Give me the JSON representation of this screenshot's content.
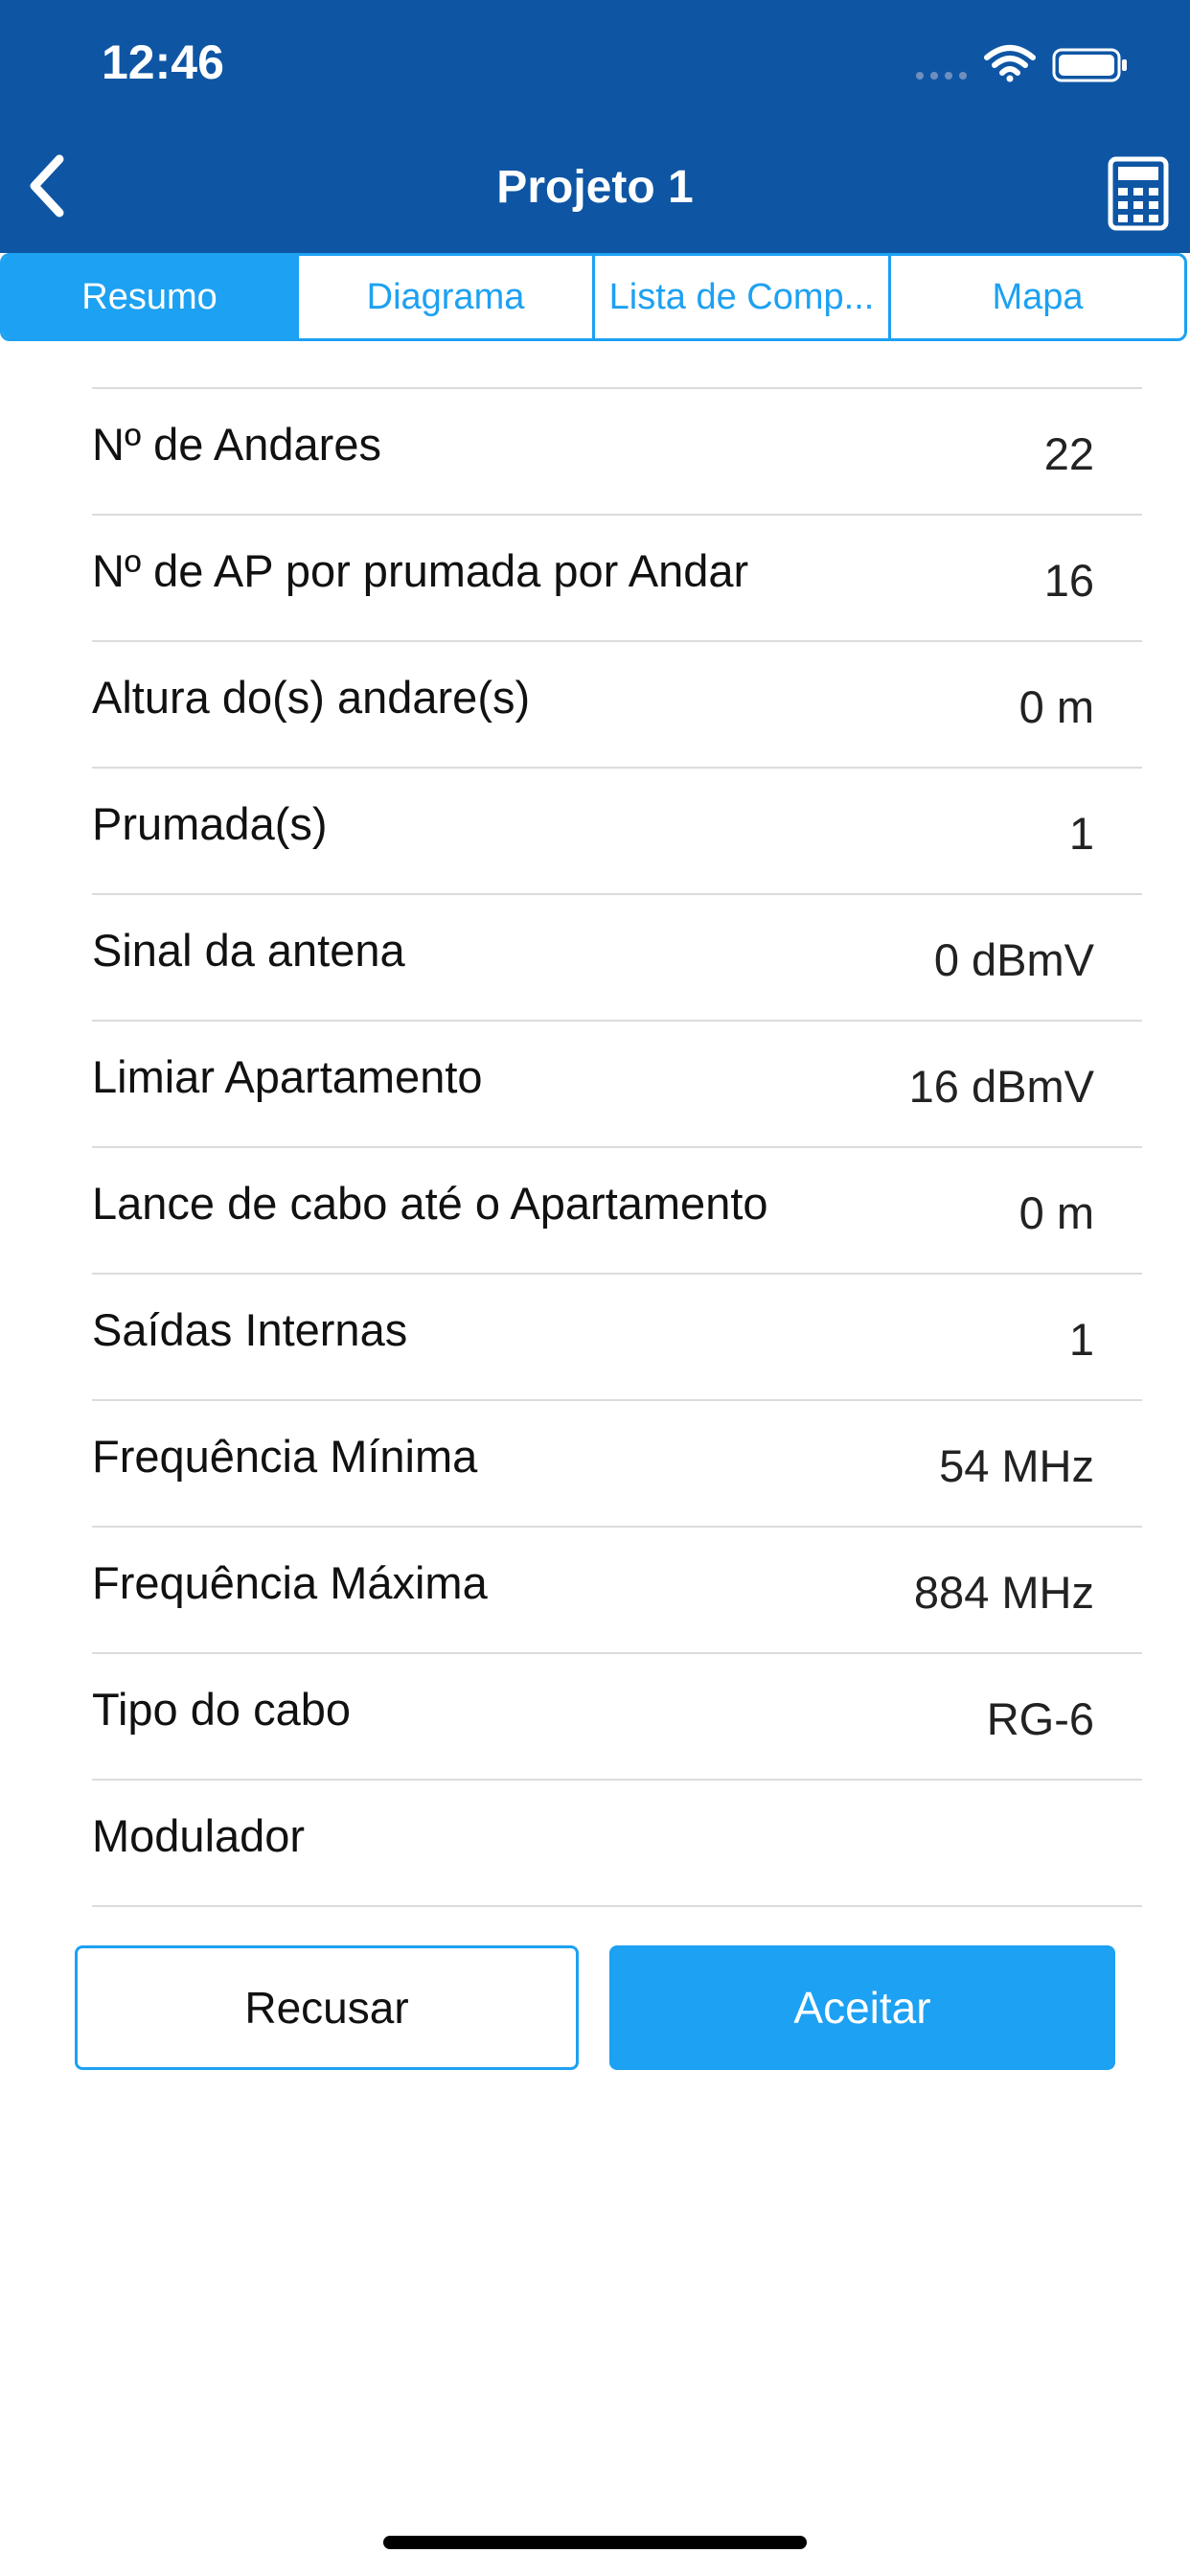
{
  "status_bar": {
    "time": "12:46"
  },
  "nav": {
    "title": "Projeto 1",
    "back_icon": "chevron-left-icon",
    "calc_icon": "calculator-icon"
  },
  "tabs": [
    {
      "label": "Resumo",
      "active": true
    },
    {
      "label": "Diagrama",
      "active": false
    },
    {
      "label": "Lista de Comp...",
      "active": false
    },
    {
      "label": "Mapa",
      "active": false
    }
  ],
  "rows": [
    {
      "label": "Nº de Andares",
      "value": "22"
    },
    {
      "label": "Nº de AP por prumada por Andar",
      "value": "16"
    },
    {
      "label": "Altura do(s) andare(s)",
      "value": "0 m"
    },
    {
      "label": "Prumada(s)",
      "value": "1"
    },
    {
      "label": "Sinal da antena",
      "value": "0 dBmV"
    },
    {
      "label": "Limiar Apartamento",
      "value": "16 dBmV"
    },
    {
      "label": "Lance de cabo até o Apartamento",
      "value": "0 m"
    },
    {
      "label": "Saídas Internas",
      "value": "1"
    },
    {
      "label": "Frequência Mínima",
      "value": "54 MHz"
    },
    {
      "label": "Frequência Máxima",
      "value": "884 MHz"
    },
    {
      "label": "Tipo do cabo",
      "value": "RG-6"
    },
    {
      "label": "Modulador",
      "value": ""
    }
  ],
  "actions": {
    "refuse_label": "Recusar",
    "accept_label": "Aceitar"
  },
  "colors": {
    "header": "#0E56A4",
    "accent": "#1DA1F2"
  }
}
